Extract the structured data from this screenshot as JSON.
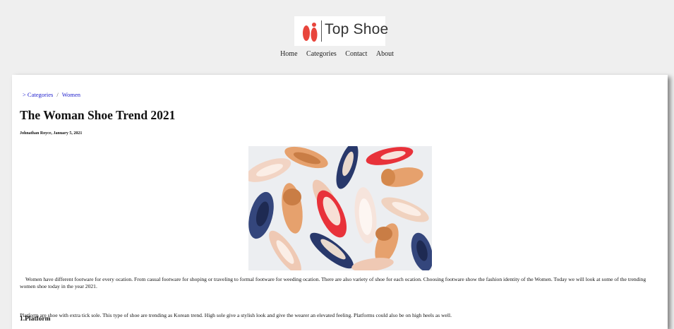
{
  "brand": {
    "name": "Top Shoe",
    "accent": "#e8453c"
  },
  "nav": {
    "items": [
      "Home",
      "Categories",
      "Contact",
      "About"
    ]
  },
  "breadcrumb": {
    "prefix": ">",
    "items": [
      "Categories",
      "Women"
    ],
    "separator": "/"
  },
  "article": {
    "title": "The Woman Shoe Trend 2021",
    "byline": "Johnathan Royce, January 5, 2021",
    "intro": "Women have different footware for every ocation. From casual footware for shoping or traveling to formal footware for weeding ocation. There are also variety of shoe for each ocation. Choosing footware show the fashion identity of the Women. Today we will look at some of the trending women shoe today in the year 2021.",
    "section_title": "1.Platform",
    "section_text": "Platform are shoe with extra tick sole. This type of shoe are trending as Korean trend. High sole give a stylish look and give the wearer an elevated feeling. Platforms could also be on high heels as well."
  }
}
